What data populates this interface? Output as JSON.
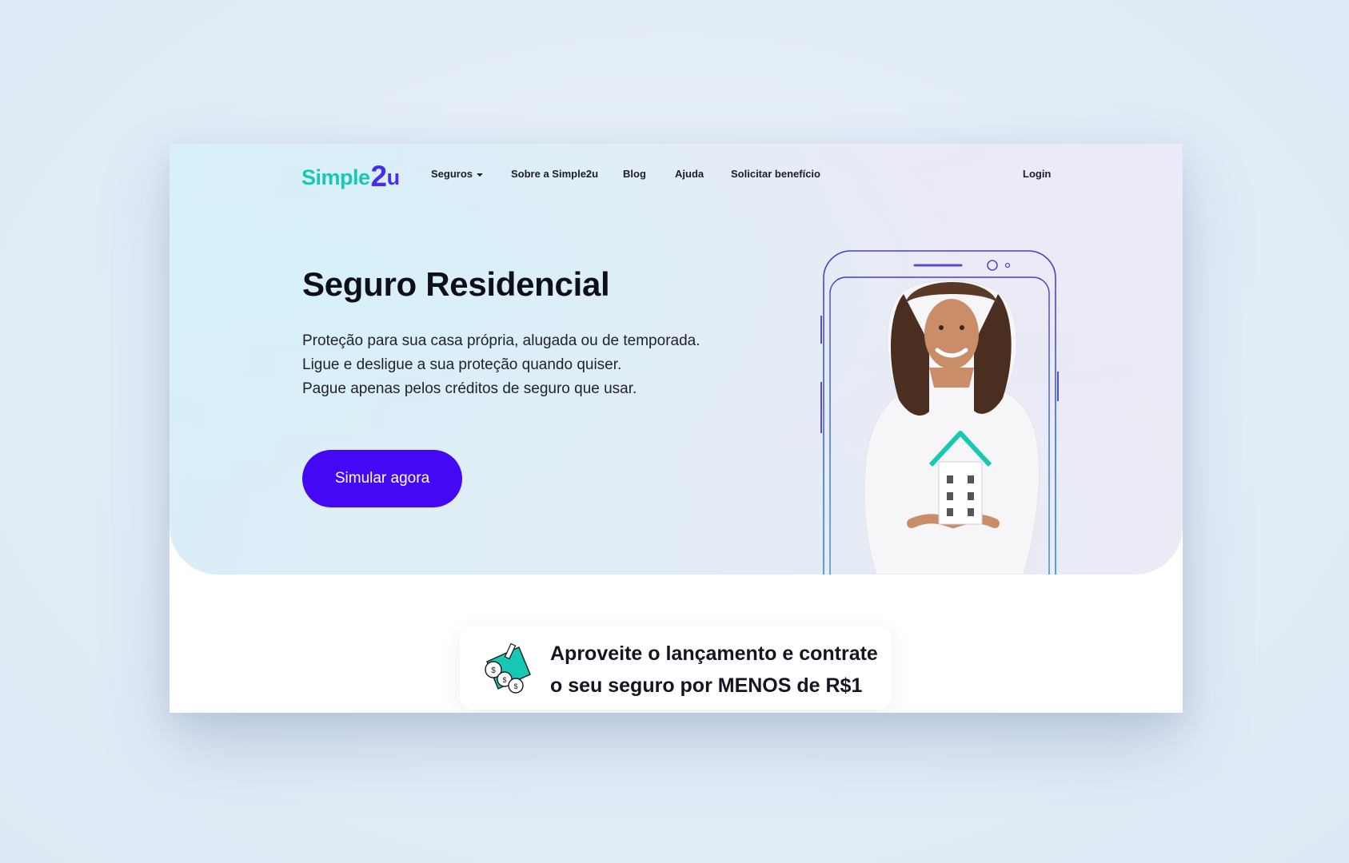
{
  "logo": {
    "part1": "Simple",
    "part2": "2",
    "part3": "u"
  },
  "nav": {
    "items": [
      "Seguros",
      "Sobre a Simple2u",
      "Blog",
      "Ajuda",
      "Solicitar benefício"
    ],
    "login": "Login"
  },
  "hero": {
    "title": "Seguro Residencial",
    "lines": [
      "Proteção para sua casa própria, alugada ou de temporada.",
      "Ligue e desligue a sua proteção quando quiser.",
      "Pague apenas pelos créditos de seguro que usar."
    ],
    "cta": "Simular agora"
  },
  "promo": {
    "line1": "Aproveite o lançamento e contrate",
    "line2": "o seu seguro por MENOS de R$1"
  },
  "colors": {
    "brand_teal": "#19c7b5",
    "brand_purple": "#4a2cf0",
    "cta": "#4408f4",
    "text_dark": "#0f0f1c"
  },
  "icons": [
    "chevron-down-icon",
    "phone-outline",
    "woman-holding-house-photo",
    "coins-money-icon"
  ]
}
